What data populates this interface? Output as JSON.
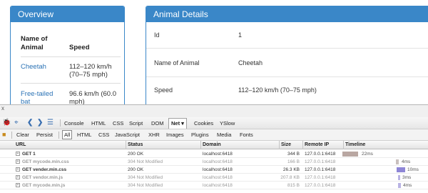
{
  "overview": {
    "title": "Overview",
    "col_animal": "Name of Animal",
    "col_speed": "Speed",
    "rows": [
      {
        "animal": "Cheetah",
        "speed": "112–120 km/h (70–75 mph)"
      },
      {
        "animal": "Free-tailed bat",
        "speed": "96.6 km/h (60.0 mph)"
      }
    ]
  },
  "details": {
    "title": "Animal Details",
    "rows": [
      {
        "label": "Id",
        "value": "1"
      },
      {
        "label": "Name of Animal",
        "value": "Cheetah"
      },
      {
        "label": "Speed",
        "value": "112–120 km/h (70–75 mph)"
      }
    ]
  },
  "devtools": {
    "close": "x",
    "tabs": [
      "Console",
      "HTML",
      "CSS",
      "Script",
      "DOM",
      "Net ▾",
      "Cookies",
      "YSlow"
    ],
    "active_tab": "Net ▾",
    "actions": [
      "Clear",
      "Persist"
    ],
    "filters": [
      "All",
      "HTML",
      "CSS",
      "JavaScript",
      "XHR",
      "Images",
      "Plugins",
      "Media",
      "Fonts"
    ],
    "active_filter": "All",
    "columns": {
      "url": "URL",
      "status": "Status",
      "domain": "Domain",
      "size": "Size",
      "ip": "Remote IP",
      "timeline": "Timeline"
    },
    "requests": [
      {
        "url": "GET 1",
        "status": "200 OK",
        "domain": "localhost:6418",
        "size": "344 B",
        "ip": "127.0.0.1:6418",
        "time": "22ms",
        "cached": false,
        "bar_color": "#b9a7a2"
      },
      {
        "url": "GET mycode.min.css",
        "status": "304 Not Modified",
        "domain": "localhost:6418",
        "size": "166 B",
        "ip": "127.0.0.1:6418",
        "time": "4ms",
        "cached": true,
        "bar_color": "#c9c0be"
      },
      {
        "url": "GET vender.min.css",
        "status": "200 OK",
        "domain": "localhost:6418",
        "size": "26.3 KB",
        "ip": "127.0.0.1:6418",
        "time": "10ms",
        "cached": false,
        "bar_color": "#8e86d6"
      },
      {
        "url": "GET vendor.min.js",
        "status": "304 Not Modified",
        "domain": "localhost:6418",
        "size": "207.8 KB",
        "ip": "127.0.0.1:6418",
        "time": "3ms",
        "cached": true,
        "bar_color": "#b9b3e4"
      },
      {
        "url": "GET mycode.min.js",
        "status": "304 Not Modified",
        "domain": "localhost:6418",
        "size": "815 B",
        "ip": "127.0.0.1:6418",
        "time": "4ms",
        "cached": true,
        "bar_color": "#b9b3e4"
      }
    ]
  }
}
